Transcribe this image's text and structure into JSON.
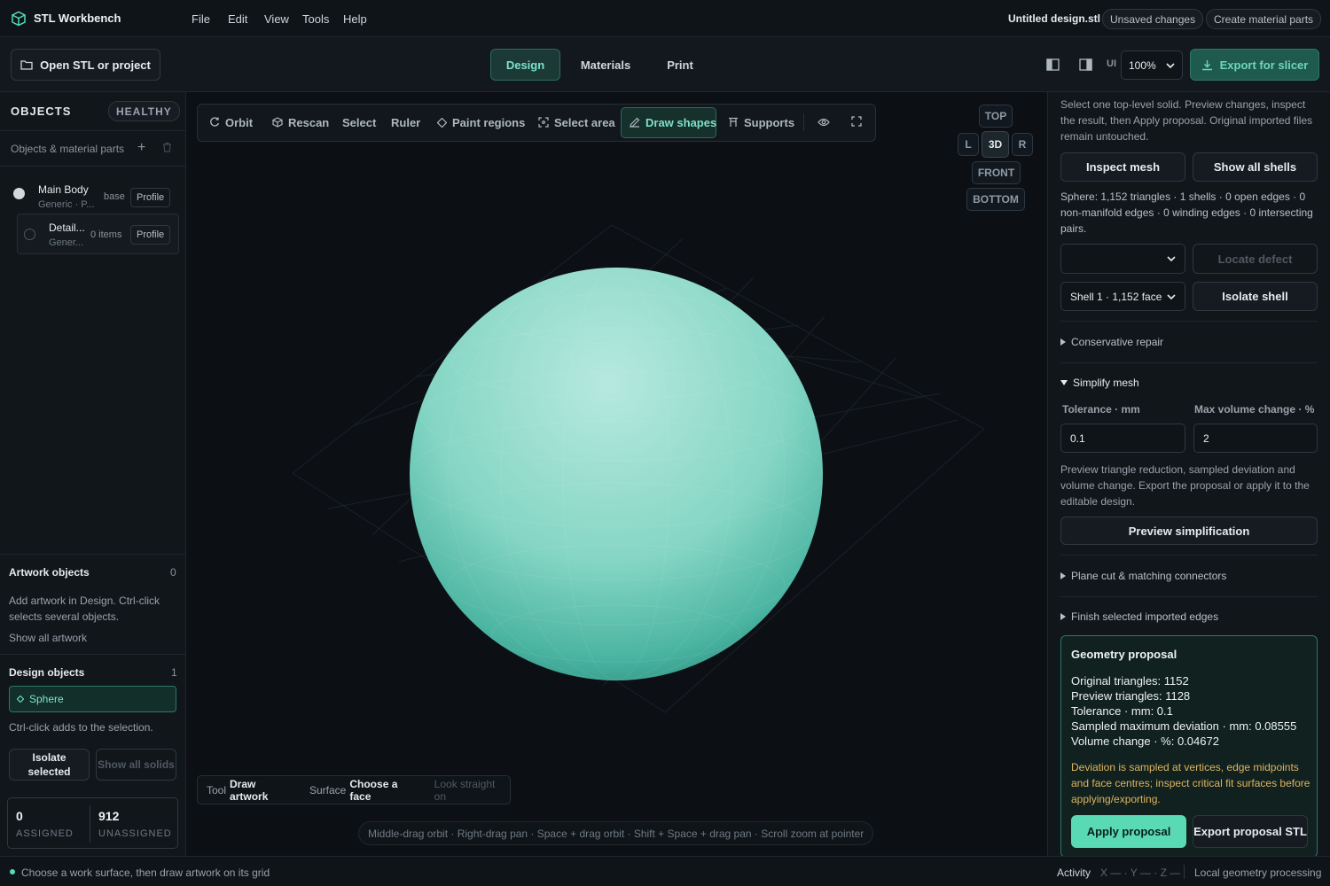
{
  "app": {
    "name": "STL Workbench"
  },
  "menu": [
    "File",
    "Edit",
    "View",
    "Tools",
    "Help"
  ],
  "header": {
    "filename": "Untitled design.stl",
    "unsaved": "Unsaved changes",
    "create_parts": "Create material parts"
  },
  "toolbar": {
    "open_label": "Open STL or project",
    "tabs": [
      "Design",
      "Materials",
      "Print"
    ],
    "active_tab": "Design",
    "ui_label": "UI",
    "zoom_value": "100%",
    "export_label": "Export for slicer"
  },
  "sidebar": {
    "objects_heading": "OBJECTS",
    "health_badge": "HEALTHY",
    "objects_sub": "Objects & material parts",
    "items": [
      {
        "name": "Main Body",
        "sub": "Generic · P...",
        "tag": "base",
        "profile": "Profile"
      },
      {
        "name": "Detail...",
        "sub": "Gener...",
        "tag": "0 items",
        "profile": "Profile"
      }
    ],
    "artwork": {
      "heading": "Artwork objects",
      "count": "0",
      "help": "Add artwork in Design. Ctrl-click selects several objects.",
      "show_all": "Show all artwork"
    },
    "design": {
      "heading": "Design objects",
      "count": "1",
      "item": "Sphere",
      "hint": "Ctrl-click adds to the selection.",
      "isolate": "Isolate selected",
      "show_all_solids": "Show all solids"
    },
    "stats": {
      "assigned_value": "0",
      "assigned_label": "ASSIGNED",
      "unassigned_value": "912",
      "unassigned_label": "UNASSIGNED"
    }
  },
  "viewport": {
    "tools": [
      "Orbit",
      "Rescan",
      "Select",
      "Ruler",
      "Paint regions",
      "Select area",
      "Draw shapes",
      "Supports"
    ],
    "active_tool": "Draw shapes",
    "views": {
      "top": "TOP",
      "left": "L",
      "three_d": "3D",
      "right": "R",
      "front": "FRONT",
      "bottom": "BOTTOM"
    },
    "status": {
      "tool_label": "Tool",
      "tool_value": "Draw artwork",
      "surface_label": "Surface",
      "surface_value": "Choose a face",
      "hint": "Look straight on"
    },
    "help": "Middle-drag orbit · Right-drag pan · Space + drag orbit · Shift + Space + drag pan · Scroll zoom at pointer",
    "colors": {
      "sphere_light": "#a8e2d6",
      "sphere_dark": "#2b8f80",
      "accent": "#55d9b8"
    }
  },
  "panel": {
    "intro": "Select one top-level solid. Preview changes, inspect the result, then Apply proposal. Original imported files remain untouched.",
    "inspect": "Inspect mesh",
    "show_shells": "Show all shells",
    "mesh_stats": "Sphere: 1,152 triangles · 1 shells · 0 open edges · 0 non-manifold edges · 0 winding edges · 0 intersecting pairs.",
    "defect_select": "",
    "locate": "Locate defect",
    "shell_select": "Shell 1 · 1,152 face",
    "isolate_shell": "Isolate shell",
    "conservative": "Conservative repair",
    "simplify": "Simplify mesh",
    "tolerance_label": "Tolerance · mm",
    "tolerance_value": "0.1",
    "maxvol_label": "Max volume change · %",
    "maxvol_value": "2",
    "simplify_help": "Preview triangle reduction, sampled deviation and volume change. Export the proposal or apply it to the editable design.",
    "preview_btn": "Preview simplification",
    "plane_cut": "Plane cut & matching connectors",
    "finish_edges": "Finish selected imported edges",
    "proposal": {
      "title": "Geometry proposal",
      "lines": [
        "Original triangles: 1152",
        "Preview triangles: 1128",
        "Tolerance · mm: 0.1",
        "Sampled maximum deviation · mm: 0.08555",
        "Volume change · %: 0.04672"
      ],
      "warning": "Deviation is sampled at vertices, edge midpoints and face centres; inspect critical fit surfaces before applying/exporting.",
      "apply": "Apply proposal",
      "export": "Export proposal STL"
    }
  },
  "statusbar": {
    "message": "Choose a work surface, then draw artwork on its grid",
    "activity": "Activity",
    "coords": "X — · Y — · Z —",
    "processing": "Local geometry processing"
  }
}
